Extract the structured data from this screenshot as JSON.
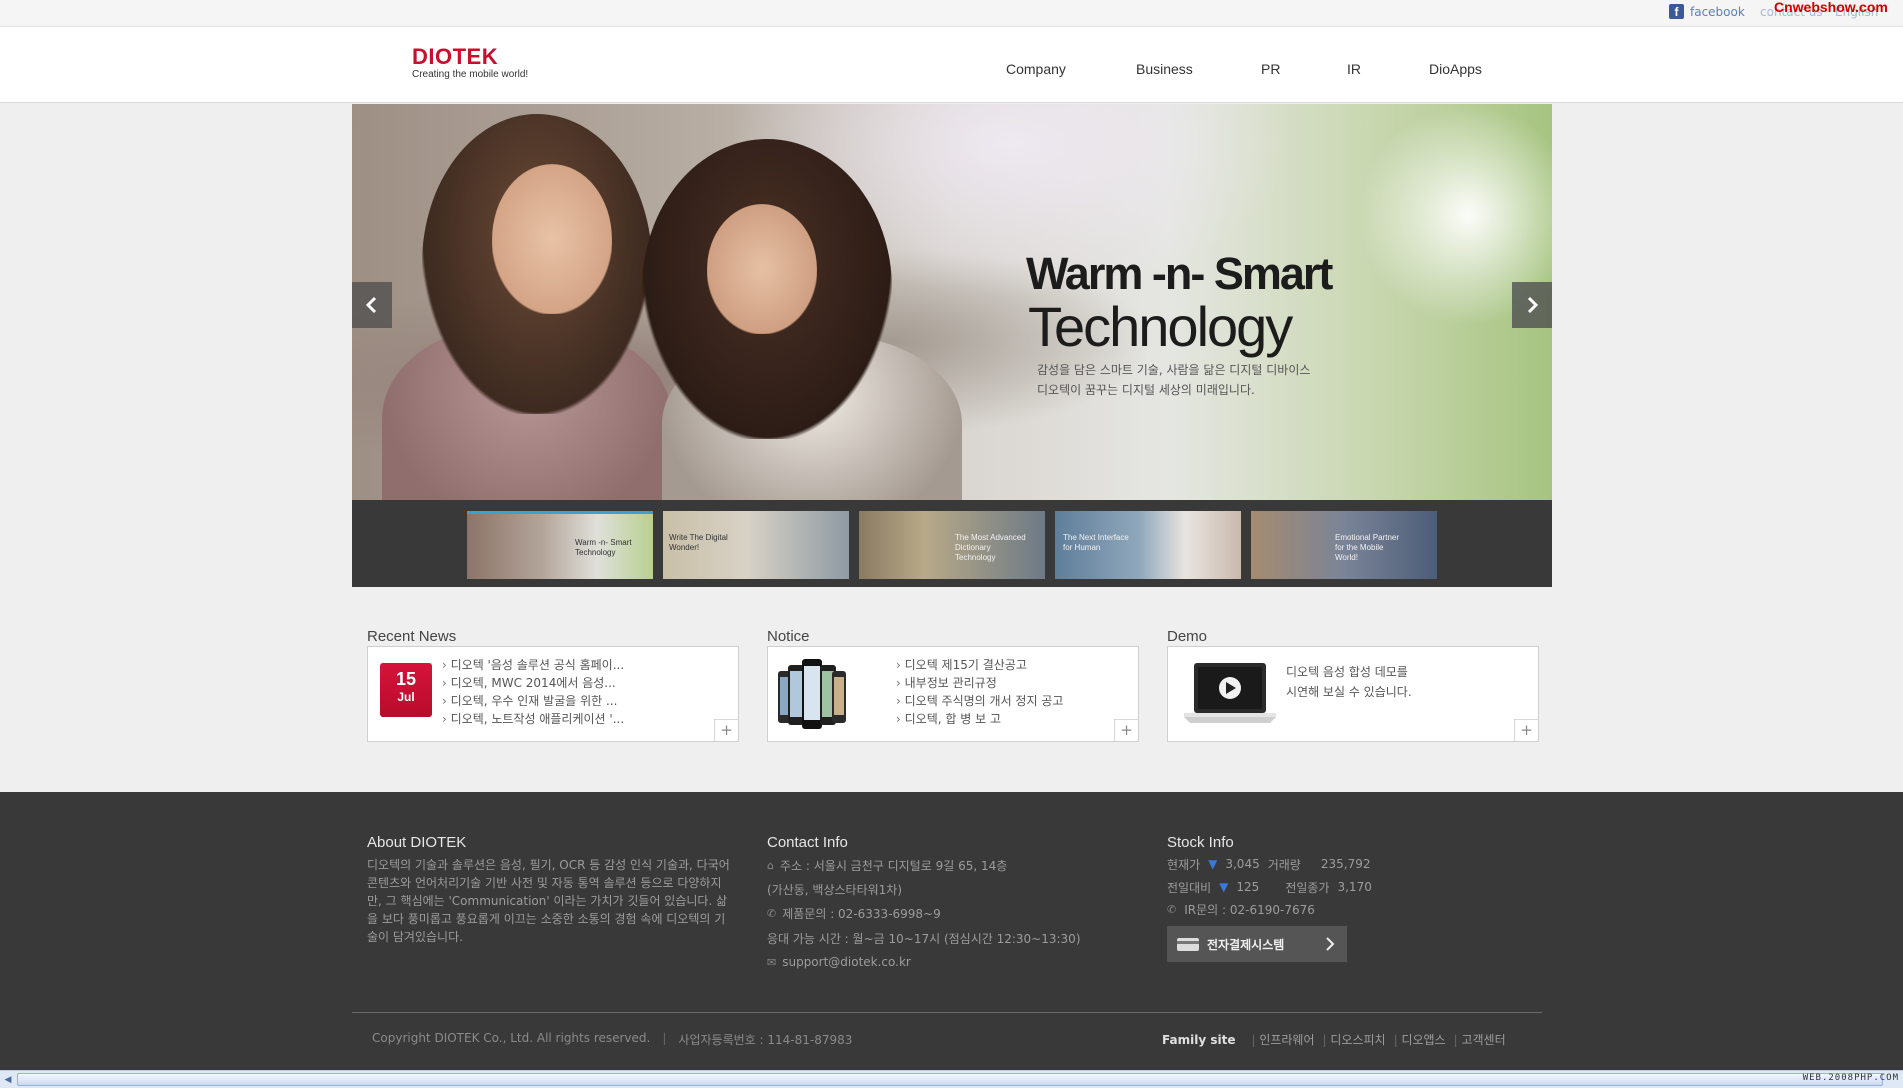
{
  "topbar": {
    "facebook_label": "facebook",
    "contact_label": "contact us",
    "language_label": "English",
    "watermark": "Cnwebshow.com"
  },
  "header": {
    "logo_text": "DIOTEK",
    "logo_tagline": "Creating the mobile world!",
    "nav": [
      {
        "label": "Company"
      },
      {
        "label": "Business"
      },
      {
        "label": "PR"
      },
      {
        "label": "IR"
      },
      {
        "label": "DioApps"
      }
    ]
  },
  "hero": {
    "headline_1": "Warm -n- Smart",
    "headline_2": "Technology",
    "sub_1": "감성을 담은 스마트 기술, 사람을 닮은 디지털 디바이스",
    "sub_2": "디오텍이 꿈꾸는 디지털 세상의 미래입니다.",
    "thumbnails": [
      {
        "caption": "Warm -n- Smart Technology"
      },
      {
        "caption": "Write The Digital Wonder!"
      },
      {
        "caption": "The Most Advanced Dictionary Technology"
      },
      {
        "caption": "The Next Interface for Human"
      },
      {
        "caption": "Emotional Partner for the Mobile World!"
      }
    ]
  },
  "recent_news": {
    "title": "Recent News",
    "date_day": "15",
    "date_month": "Jul",
    "items": [
      "디오텍 '음성 솔루션 공식 홈페이...",
      "디오텍, MWC 2014에서 음성...",
      "디오텍, 우수 인재 발굴을 위한 ...",
      "디오텍, 노트작성 애플리케이션 '..."
    ]
  },
  "notice": {
    "title": "Notice",
    "items": [
      "디오텍 제15기 결산공고",
      "내부정보 관리규정",
      "디오텍 주식명의 개서 정지 공고",
      "디오텍, 합 병 보 고"
    ]
  },
  "demo": {
    "title": "Demo",
    "line_1": "디오텍 음성 합성 데모를",
    "line_2": "시연해 보실 수 있습니다."
  },
  "footer": {
    "about_title": "About DIOTEK",
    "about_text": "디오텍의 기술과 솔루션은 음성, 필기, OCR 등 감성 인식 기술과, 다국어 콘텐츠와 언어처리기술 기반 사전 및 자동 통역 솔루션 등으로 다양하지만, 그 핵심에는 'Communication' 이라는 가치가 깃들어 있습니다. 삶을 보다 풍미롭고 풍요롭게 이끄는 소중한 소통의 경험 속에 디오텍의 기술이 담겨있습니다.",
    "contact_title": "Contact Info",
    "address_1": "주소 : 서울시 금천구 디지털로 9길 65, 14층",
    "address_2": "(가산동, 백상스타타워1차)",
    "phone": "제품문의 : 02-6333-6998~9",
    "hours": "응대 가능 시간 : 월~금 10~17시 (점심시간 12:30~13:30)",
    "email": "support@diotek.co.kr",
    "stock_title": "Stock Info",
    "current_label": "현재가",
    "current_value": "3,045",
    "volume_label": "거래량",
    "volume_value": "235,792",
    "change_label": "전일대비",
    "change_value": "125",
    "prev_volume_label": "전일종가",
    "prev_volume_value": "3,170",
    "ir_contact": "IR문의 : 02-6190-7676",
    "payment_button": "전자결제시스템",
    "copyright": "Copyright DIOTEK Co., Ltd. All rights reserved.",
    "business_number": "사업자등록번호 : 114-81-87983",
    "family_label": "Family site",
    "family_links": [
      "인프라웨어",
      "디오스피치",
      "디오앱스",
      "고객센터"
    ]
  },
  "browser": {
    "brand": "WEB.2008PHP.COM"
  }
}
